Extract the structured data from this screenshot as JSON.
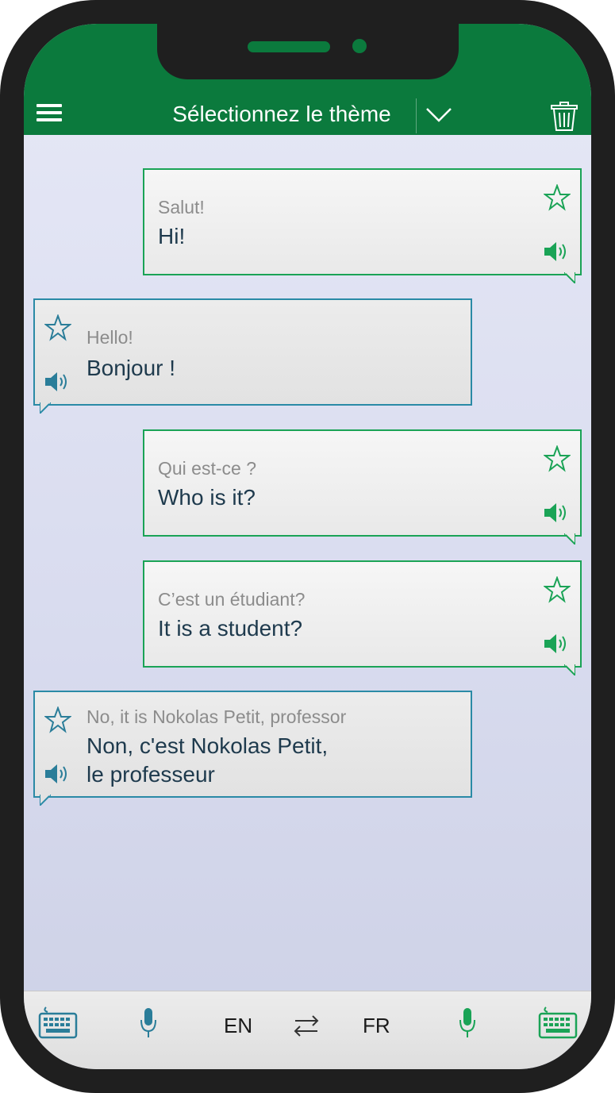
{
  "header": {
    "title": "Sélectionnez le thème"
  },
  "messages": [
    {
      "side": "right",
      "secondary": "Salut!",
      "primary": "Hi!"
    },
    {
      "side": "left",
      "secondary": "Hello!",
      "primary": "Bonjour !"
    },
    {
      "side": "right",
      "secondary": "Qui est-ce ?",
      "primary": "Who is it?"
    },
    {
      "side": "right",
      "secondary": "C’est un étudiant?",
      "primary": "It is a student?"
    },
    {
      "side": "left",
      "secondary": "No, it is Nokolas Petit,  professor",
      "primary_line1": "Non, c'est Nokolas Petit,",
      "primary_line2": "le professeur"
    }
  ],
  "bottom": {
    "source_lang": "EN",
    "target_lang": "FR"
  },
  "colors": {
    "brand_green": "#0b7a3d",
    "right_border": "#1aa356",
    "left_border": "#2a8aa6",
    "left_icon": "#2a7d99"
  },
  "icons": [
    "menu-icon",
    "chevron-down-icon",
    "trash-icon",
    "star-icon",
    "speaker-icon",
    "keyboard-icon",
    "microphone-icon",
    "swap-icon"
  ]
}
